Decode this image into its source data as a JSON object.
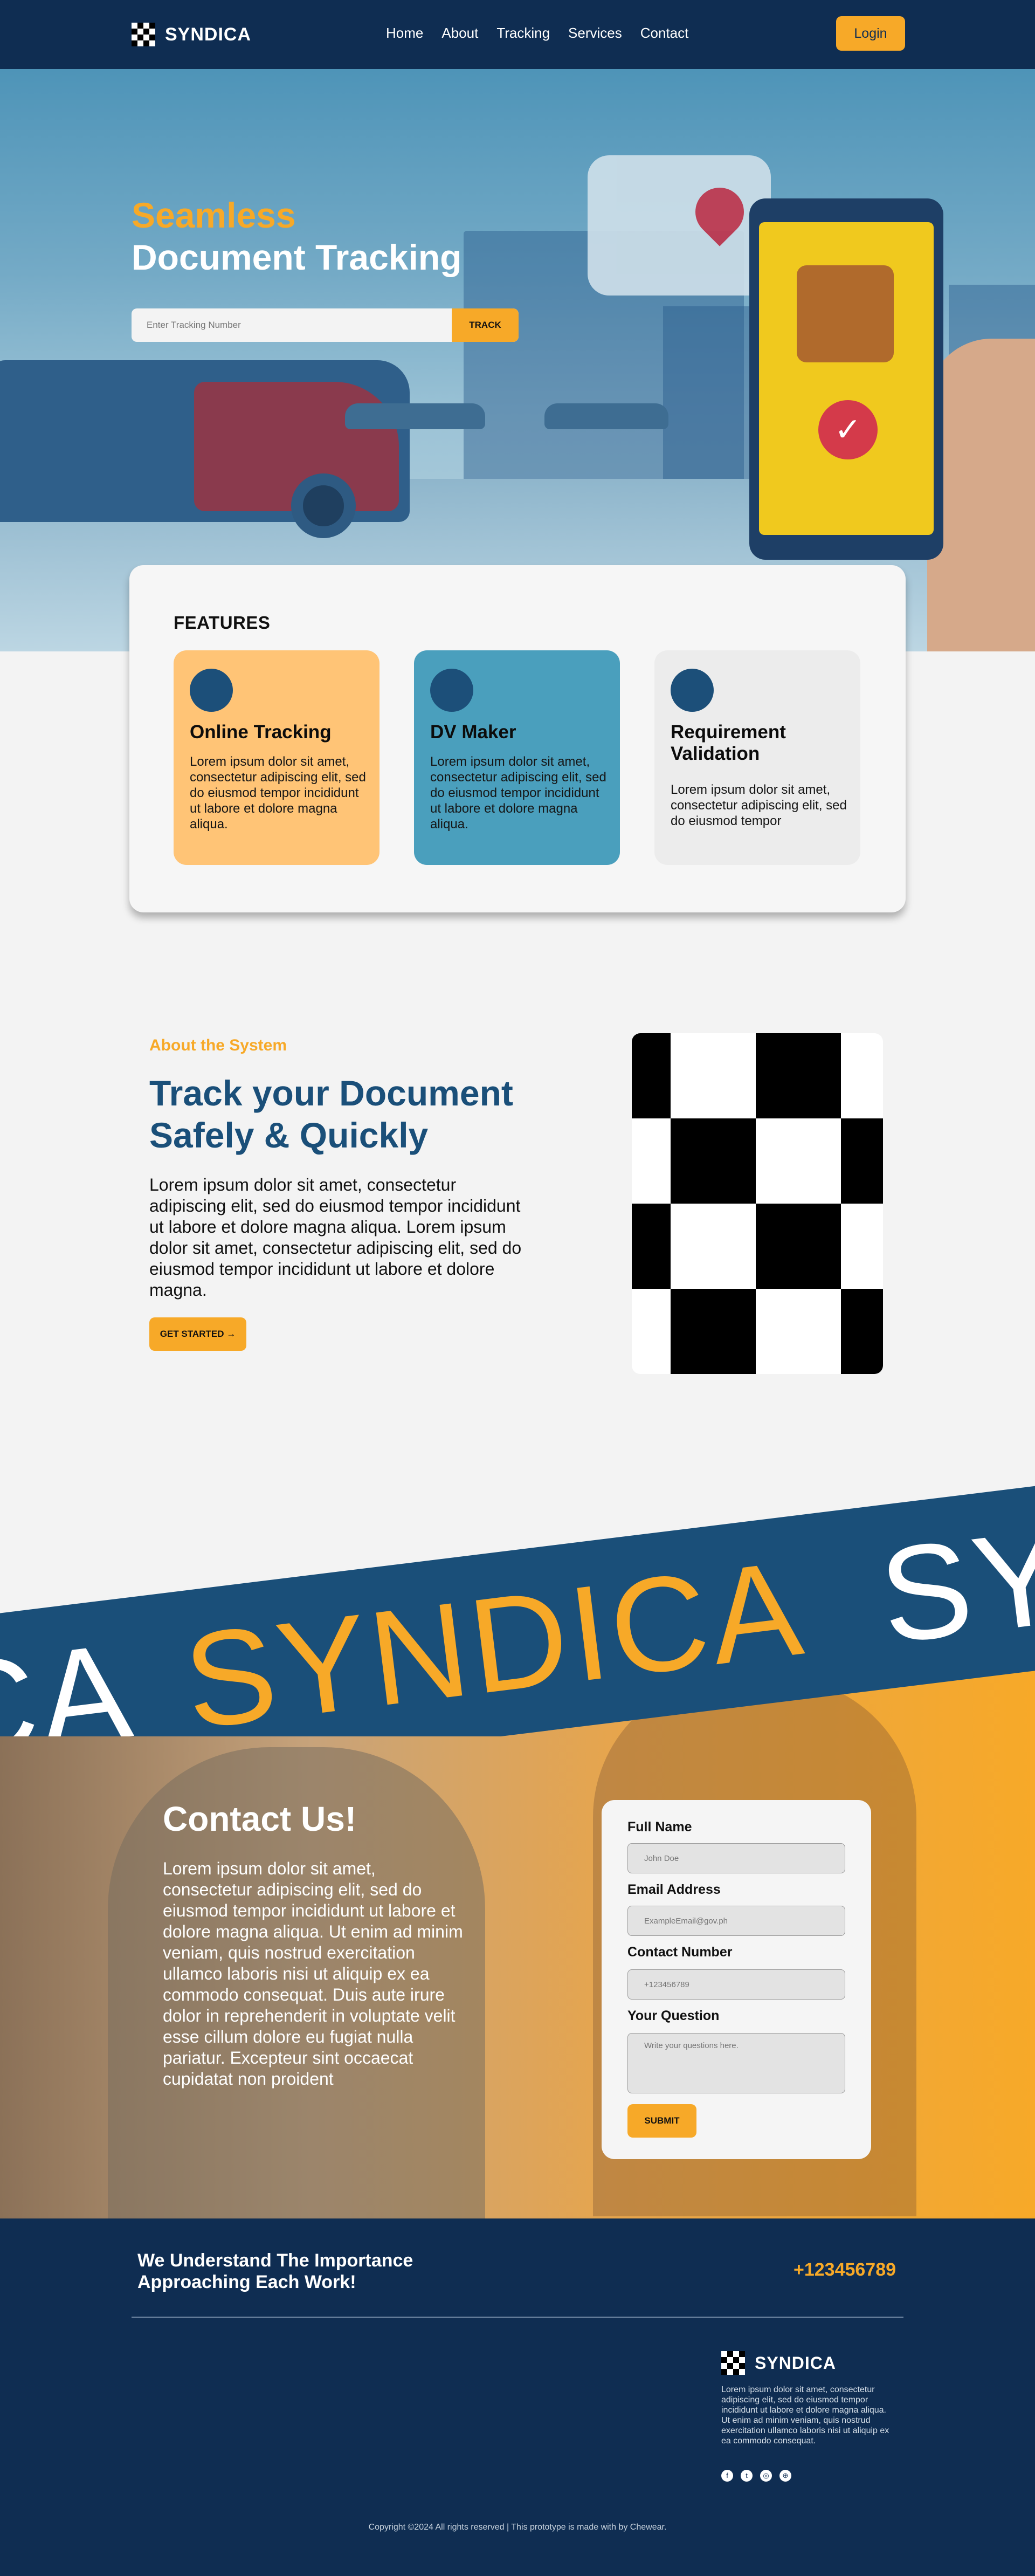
{
  "brand": {
    "name": "SYNDICA"
  },
  "nav": {
    "links": [
      "Home",
      "About",
      "Tracking",
      "Services",
      "Contact"
    ],
    "login_label": "Login"
  },
  "hero": {
    "title_line1": "Seamless",
    "title_line2": "Document Tracking",
    "tracking_placeholder": "Enter Tracking Number",
    "track_label": "TRACK"
  },
  "features": {
    "heading": "FEATURES",
    "cards": [
      {
        "title": "Online Tracking",
        "text": "Lorem ipsum dolor sit amet, consectetur adipiscing elit, sed do eiusmod tempor incididunt ut labore et dolore magna aliqua.",
        "color": "#ffc476"
      },
      {
        "title": "DV Maker",
        "text": "Lorem ipsum dolor sit amet, consectetur adipiscing elit, sed do eiusmod tempor incididunt ut labore et dolore magna aliqua.",
        "color": "#4a9fbd"
      },
      {
        "title": "Requirement Validation",
        "text": "Lorem ipsum dolor sit amet, consectetur adipiscing elit, sed do eiusmod tempor",
        "color": "#ececec"
      }
    ]
  },
  "about": {
    "kicker": "About the System",
    "title": "Track your Document Safely & Quickly",
    "text": "Lorem ipsum dolor sit amet, consectetur adipiscing elit, sed do eiusmod tempor incididunt ut labore et dolore magna aliqua. Lorem ipsum dolor sit amet, consectetur adipiscing elit, sed do eiusmod tempor incididunt ut labore et dolore magna.",
    "cta_label": "GET STARTED →"
  },
  "banner": {
    "words": [
      "CA",
      "SYNDICA",
      "SY"
    ]
  },
  "contact": {
    "title": "Contact Us!",
    "text": "Lorem ipsum dolor sit amet, consectetur adipiscing elit, sed do eiusmod tempor incididunt ut labore et dolore magna aliqua. Ut enim ad minim veniam, quis nostrud exercitation ullamco laboris nisi ut aliquip ex ea commodo consequat. Duis aute irure dolor in reprehenderit in voluptate velit esse cillum dolore eu fugiat nulla pariatur. Excepteur sint occaecat cupidatat non proident",
    "form": {
      "name_label": "Full Name",
      "name_placeholder": "John Doe",
      "email_label": "Email Address",
      "email_placeholder": "ExampleEmail@gov.ph",
      "phone_label": "Contact Number",
      "phone_placeholder": "+123456789",
      "question_label": "Your Question",
      "question_placeholder": "Write your questions here.",
      "submit_label": "SUBMIT"
    }
  },
  "footer": {
    "tagline": "We Understand The Importance Approaching Each Work!",
    "phone": "+123456789",
    "description": "Lorem ipsum dolor sit amet, consectetur adipiscing elit, sed do eiusmod tempor incididunt ut labore et dolore magna aliqua. Ut enim ad minim veniam, quis nostrud exercitation ullamco laboris nisi ut aliquip ex ea commodo consequat.",
    "social_icons": [
      "facebook-icon",
      "twitter-icon",
      "instagram-icon",
      "globe-icon"
    ],
    "copyright": "Copyright ©2024 All rights reserved | This prototype is made with by Chewear."
  },
  "colors": {
    "navy": "#0f2d52",
    "accent": "#f7a928",
    "blue": "#1a4f79"
  }
}
